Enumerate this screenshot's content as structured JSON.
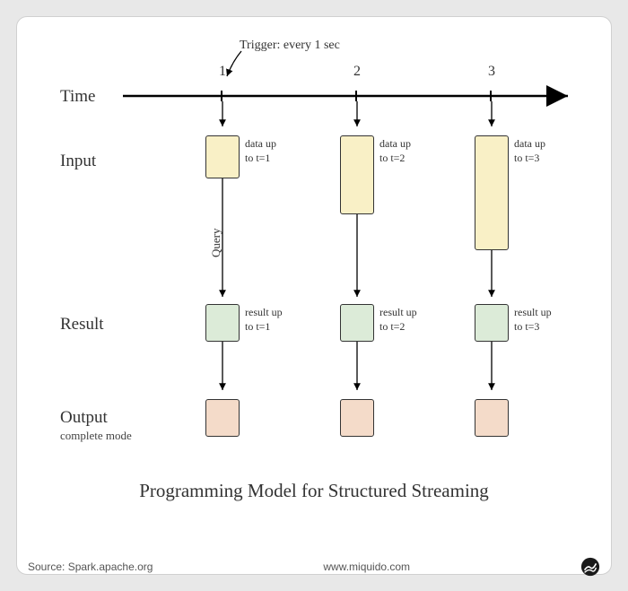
{
  "trigger_text": "Trigger: every 1 sec",
  "row_labels": {
    "time": "Time",
    "input": "Input",
    "result": "Result",
    "output": "Output",
    "output_sub": "complete mode"
  },
  "ticks": [
    "1",
    "2",
    "3"
  ],
  "columns": [
    {
      "input_caption": "data up\nto t=1",
      "result_caption": "result up\nto t=1",
      "input_height": 48
    },
    {
      "input_caption": "data up\nto t=2",
      "result_caption": "result up\nto t=2",
      "input_height": 88
    },
    {
      "input_caption": "data up\nto t=3",
      "result_caption": "result up\nto t=3",
      "input_height": 128
    }
  ],
  "query_label": "Query",
  "caption": "Programming Model for Structured Streaming",
  "footer": {
    "source": "Source: Spark.apache.org",
    "site": "www.miquido.com"
  },
  "colors": {
    "input": "#f9f0c6",
    "result": "#dcebd8",
    "output": "#f4dbc9"
  }
}
